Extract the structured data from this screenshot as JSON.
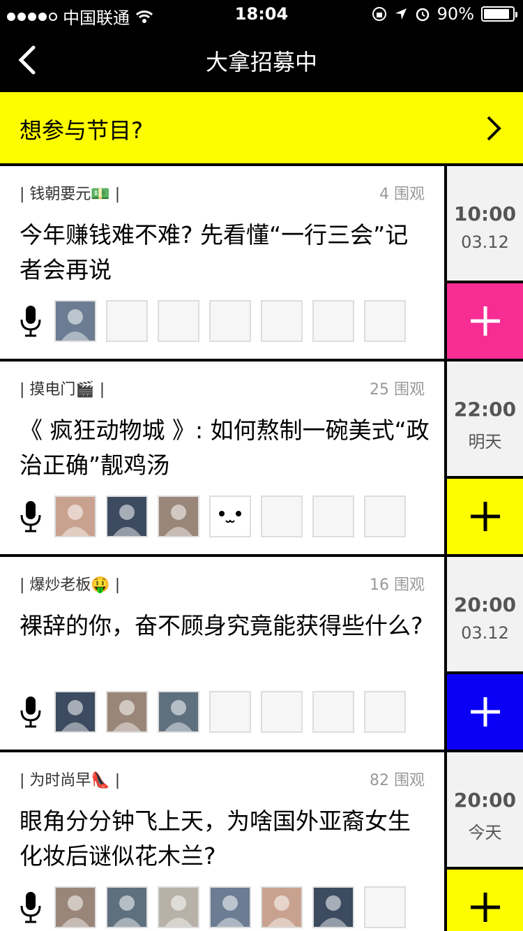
{
  "status": {
    "carrier": "中国联通",
    "time": "18:04",
    "battery": "90%",
    "battery_level": 0.9
  },
  "nav": {
    "title": "大拿招募中"
  },
  "banner": {
    "text": "想参与节目?"
  },
  "items": [
    {
      "tag": "| 钱朝要元💵 |",
      "views": "4 围观",
      "title": "今年赚钱难不难? 先看懂“一行三会”记者会再说",
      "time": "10:00",
      "date": "03.12",
      "plus_color": "#f72d93",
      "plus_icon_color": "#ffffff",
      "avatars": [
        "photo",
        "empty",
        "empty",
        "empty",
        "empty",
        "empty",
        "empty"
      ]
    },
    {
      "tag": "| 摸电门🎬 |",
      "views": "25 围观",
      "title": "《 疯狂动物城 》: 如何熬制一碗美式“政治正确”靓鸡汤",
      "time": "22:00",
      "date": "明天",
      "plus_color": "#fdfd00",
      "plus_icon_color": "#000000",
      "avatars": [
        "photo",
        "photo",
        "photo",
        "face",
        "empty",
        "empty",
        "empty"
      ]
    },
    {
      "tag": "| 爆炒老板🤑 |",
      "views": "16 围观",
      "title": "裸辞的你，奋不顾身究竟能获得些什么?",
      "time": "20:00",
      "date": "03.12",
      "plus_color": "#0a00f5",
      "plus_icon_color": "#ffffff",
      "avatars": [
        "photo",
        "photo",
        "photo",
        "empty",
        "empty",
        "empty",
        "empty"
      ]
    },
    {
      "tag": "| 为时尚早👠 |",
      "views": "82 围观",
      "title": "眼角分分钟飞上天，为啥国外亚裔女生化妆后谜似花木兰?",
      "time": "20:00",
      "date": "今天",
      "plus_color": "#fdfd00",
      "plus_icon_color": "#000000",
      "avatars": [
        "photo",
        "photo",
        "photo",
        "photo",
        "photo",
        "photo",
        "empty"
      ]
    }
  ]
}
